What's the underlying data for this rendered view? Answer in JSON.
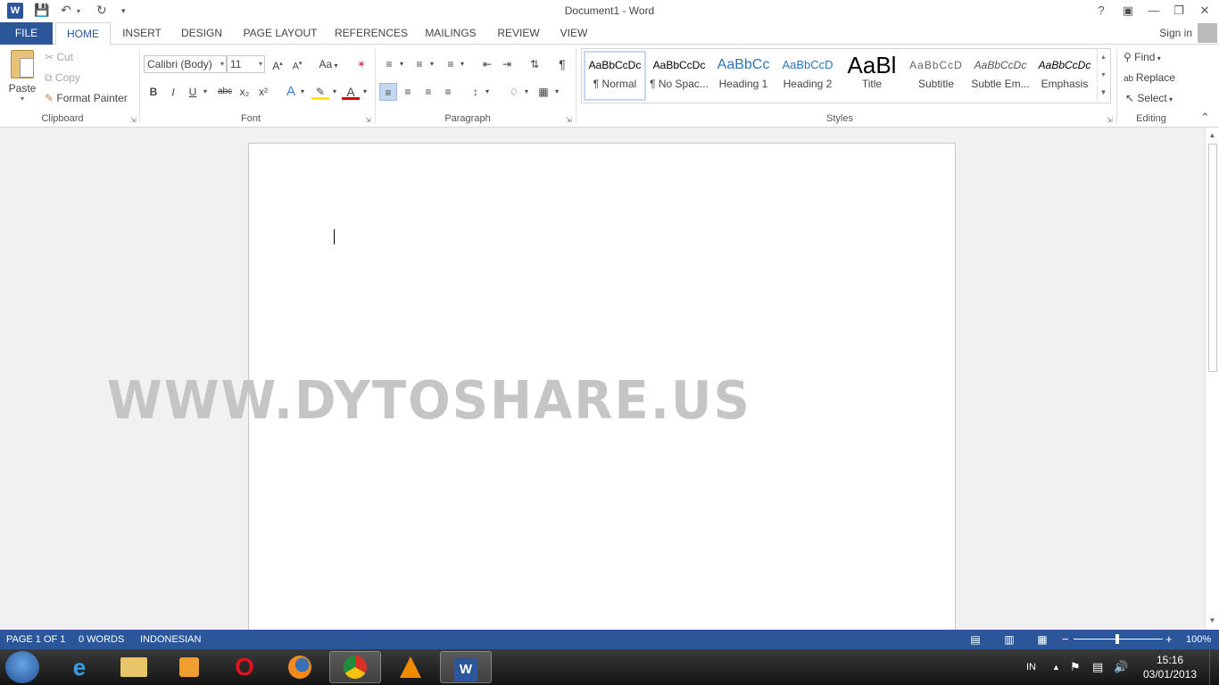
{
  "window": {
    "title": "Document1 - Word",
    "help": "?",
    "signin": "Sign in"
  },
  "tabs": {
    "file": "FILE",
    "items": [
      "HOME",
      "INSERT",
      "DESIGN",
      "PAGE LAYOUT",
      "REFERENCES",
      "MAILINGS",
      "REVIEW",
      "VIEW"
    ],
    "active": "HOME"
  },
  "ribbon": {
    "clipboard": {
      "paste": "Paste",
      "cut": "Cut",
      "copy": "Copy",
      "format_painter": "Format Painter",
      "label": "Clipboard"
    },
    "font": {
      "font_name": "Calibri (Body)",
      "font_size": "11",
      "change_case": "Aa",
      "bold": "B",
      "italic": "I",
      "underline": "U",
      "strikethrough": "abc",
      "subscript": "x₂",
      "superscript": "x²",
      "label": "Font"
    },
    "paragraph": {
      "label": "Paragraph"
    },
    "styles": {
      "items": [
        {
          "sample": "AaBbCcDc",
          "name": "¶ Normal"
        },
        {
          "sample": "AaBbCcDc",
          "name": "¶ No Spac..."
        },
        {
          "sample": "AaBbCc",
          "name": "Heading 1"
        },
        {
          "sample": "AaBbCcD",
          "name": "Heading 2"
        },
        {
          "sample": "AaBl",
          "name": "Title"
        },
        {
          "sample": "AaBbCcD",
          "name": "Subtitle"
        },
        {
          "sample": "AaBbCcDc",
          "name": "Subtle Em..."
        },
        {
          "sample": "AaBbCcDc",
          "name": "Emphasis"
        }
      ],
      "label": "Styles"
    },
    "editing": {
      "find": "Find",
      "replace": "Replace",
      "select": "Select",
      "label": "Editing"
    }
  },
  "document": {
    "watermark": "WWW.DYTOSHARE.US"
  },
  "statusbar": {
    "page": "PAGE 1 OF 1",
    "words": "0 WORDS",
    "language": "INDONESIAN",
    "zoom": "100%",
    "zoom_value": 100
  },
  "taskbar": {
    "language": "IN",
    "time": "15:16",
    "date": "03/01/2013"
  },
  "colors": {
    "accent": "#2b579a",
    "watermark": "#c5c5c5"
  }
}
